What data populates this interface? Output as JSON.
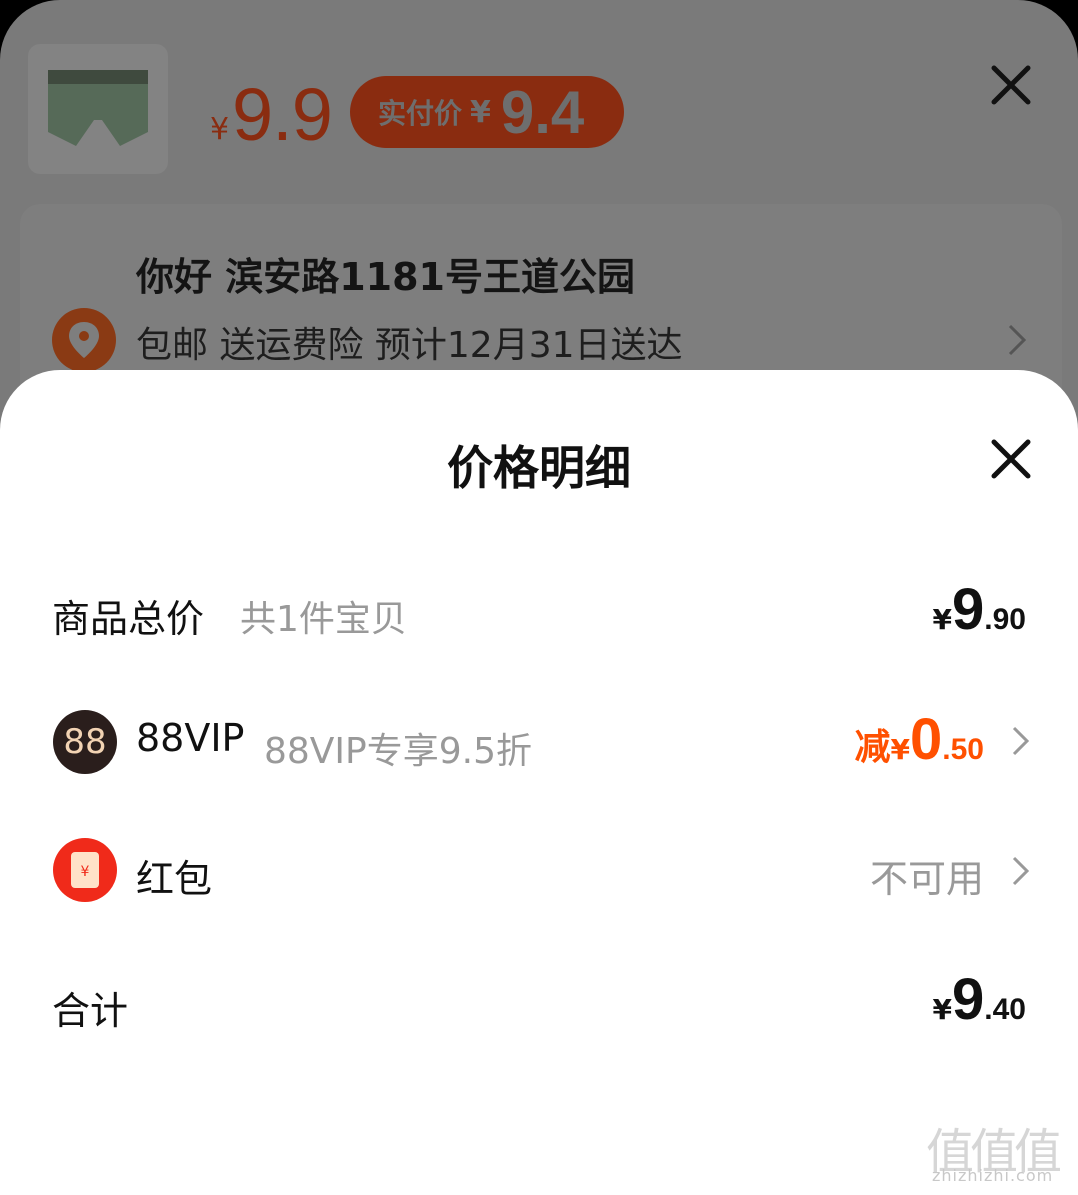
{
  "background": {
    "price": {
      "currency": "¥",
      "amount": "9.9"
    },
    "paid_price": {
      "label": "实付价",
      "currency": "¥",
      "amount": "9.4"
    },
    "close_icon": "close-icon",
    "address": {
      "title": "你好 滨安路1181号王道公园",
      "subtitle": "包邮 送运费险 预计12月31日送达",
      "icon": "location-pin-icon"
    }
  },
  "sheet": {
    "title": "价格明细",
    "close_icon": "close-icon",
    "rows": {
      "total_goods": {
        "label": "商品总价",
        "sub": "共1件宝贝",
        "currency": "¥",
        "integer": "9",
        "decimal": ".90"
      },
      "vip": {
        "badge": "88",
        "label": "88VIP",
        "sub": "88VIP专享9.5折",
        "prefix": "减",
        "currency": "¥",
        "integer": "0",
        "decimal": ".50"
      },
      "red_packet": {
        "label": "红包",
        "status": "不可用",
        "icon_glyph": "¥"
      },
      "total": {
        "label": "合计",
        "currency": "¥",
        "integer": "9",
        "decimal": ".40"
      }
    }
  },
  "watermark": {
    "chars": "值值值",
    "url": "zhizhizhi.com"
  },
  "colors": {
    "accent": "#ff5000",
    "muted_text": "#999999",
    "overlay": "#7a7a7a",
    "vip_badge": "#2a1e1c",
    "red_packet": "#f02a1a"
  }
}
